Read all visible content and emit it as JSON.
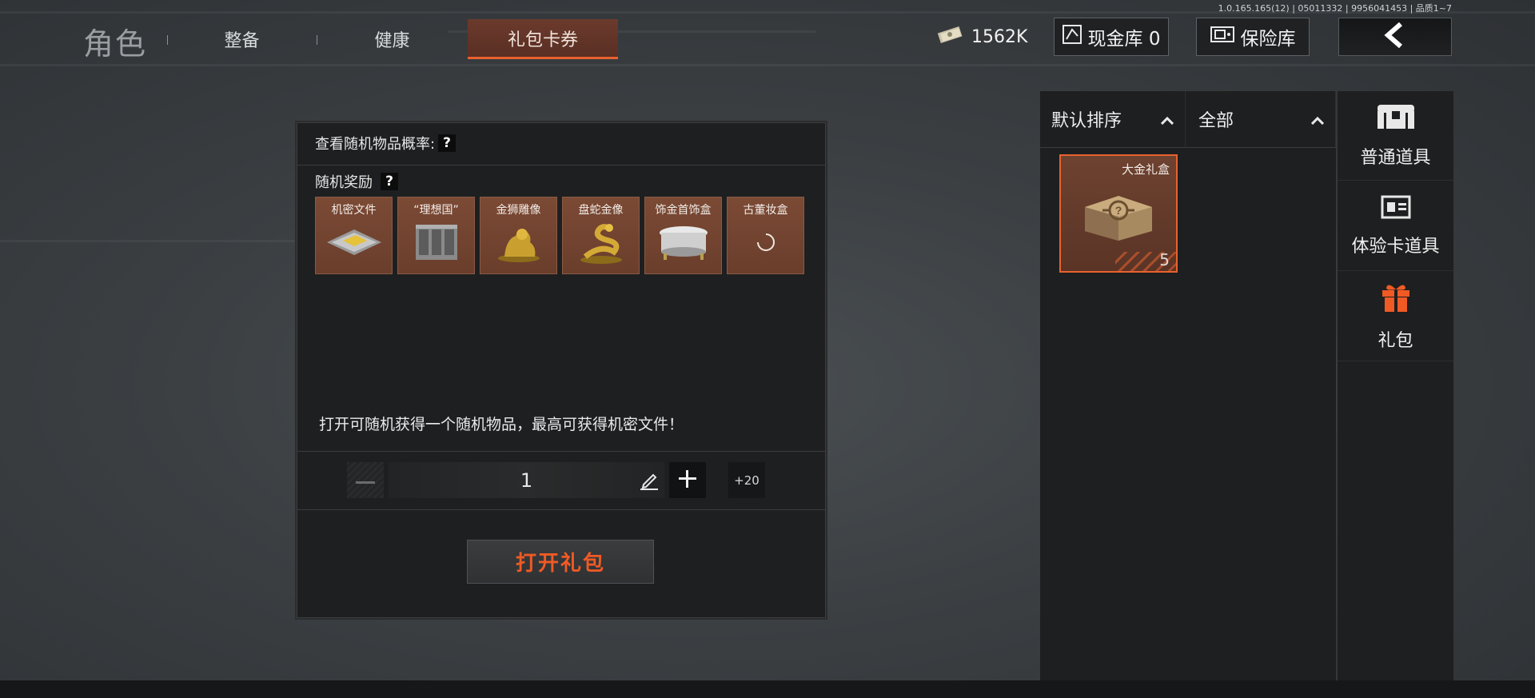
{
  "version": "1.0.165.165(12) | 05011332 | 9956041453 | 品质1~7",
  "nav": {
    "title": "角色",
    "tabs": [
      {
        "label": "整备"
      },
      {
        "label": "健康"
      },
      {
        "label": "礼包卡券"
      }
    ]
  },
  "topbar": {
    "money": "1562K",
    "cash_vault": "现金库 0",
    "safe": "保险库"
  },
  "panel": {
    "probability_label": "查看随机物品概率:",
    "probability_help": "?",
    "rewards_label": "随机奖励",
    "rewards_help": "?",
    "rewards": [
      {
        "name": "机密文件",
        "icon": "document-tray-icon"
      },
      {
        "name": "“理想国”",
        "icon": "crate-icon"
      },
      {
        "name": "金狮雕像",
        "icon": "lion-statue-icon"
      },
      {
        "name": "盘蛇金像",
        "icon": "snake-statue-icon"
      },
      {
        "name": "饰金首饰盒",
        "icon": "jewelry-box-icon"
      },
      {
        "name": "古董妆盒",
        "icon": "loading-icon"
      }
    ],
    "description": "打开可随机获得一个随机物品，最高可获得机密文件！",
    "quantity": "1",
    "plus20": "+20",
    "open_button": "打开礼包"
  },
  "inventory": {
    "sort_label": "默认排序",
    "filter_label": "全部",
    "items": [
      {
        "name": "大金礼盒",
        "count": "5"
      }
    ]
  },
  "categories": [
    {
      "label": "普通道具",
      "icon": "chest-icon"
    },
    {
      "label": "体验卡道具",
      "icon": "card-icon"
    },
    {
      "label": "礼包",
      "icon": "gift-icon"
    }
  ],
  "colors": {
    "accent": "#e8622f",
    "panel_bg": "#1e1f20",
    "reward_bg": "#6a3e2c"
  }
}
